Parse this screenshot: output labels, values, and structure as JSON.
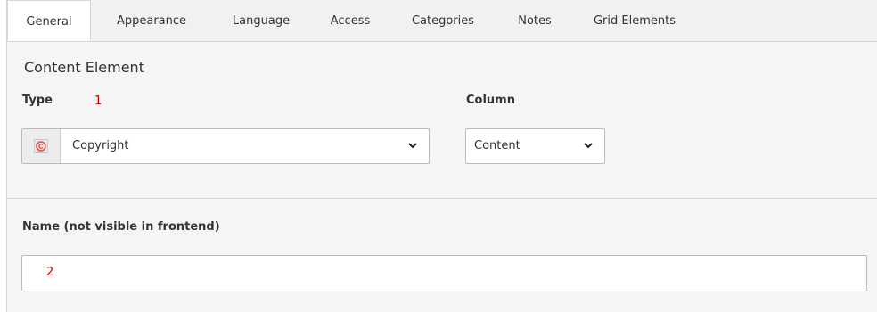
{
  "tabs": [
    {
      "label": "General",
      "active": true
    },
    {
      "label": "Appearance",
      "active": false
    },
    {
      "label": "Language",
      "active": false
    },
    {
      "label": "Access",
      "active": false
    },
    {
      "label": "Categories",
      "active": false
    },
    {
      "label": "Notes",
      "active": false
    },
    {
      "label": "Grid Elements",
      "active": false
    }
  ],
  "section": {
    "title": "Content Element"
  },
  "type_field": {
    "label": "Type",
    "annotation": "1",
    "selected": "Copyright",
    "icon": "copyright-icon"
  },
  "column_field": {
    "label": "Column",
    "selected": "Content"
  },
  "name_field": {
    "label": "Name (not visible in frontend)",
    "annotation": "2",
    "value": ""
  },
  "colors": {
    "annotation": "#cc0000",
    "icon_accent": "#e05050"
  }
}
